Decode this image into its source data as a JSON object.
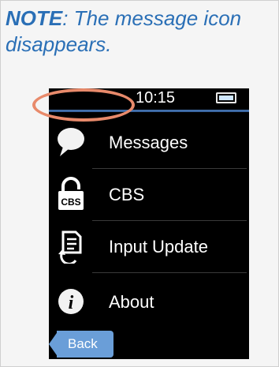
{
  "note": {
    "prefix": "NOTE",
    "text": ":  The message icon disappears."
  },
  "status_bar": {
    "time": "10:15",
    "battery_icon": "battery-icon"
  },
  "menu": [
    {
      "label": "Messages",
      "icon": "speech-bubble-icon"
    },
    {
      "label": "CBS",
      "icon": "cbs-lock-icon"
    },
    {
      "label": "Input Update",
      "icon": "document-refresh-icon"
    },
    {
      "label": "About",
      "icon": "info-icon"
    }
  ],
  "back_button": {
    "label": "Back"
  },
  "colors": {
    "note_text": "#2a6fb6",
    "highlight_ellipse": "#e88a6b",
    "status_line": "#4a79b6",
    "back_button": "#6a9ed8"
  }
}
